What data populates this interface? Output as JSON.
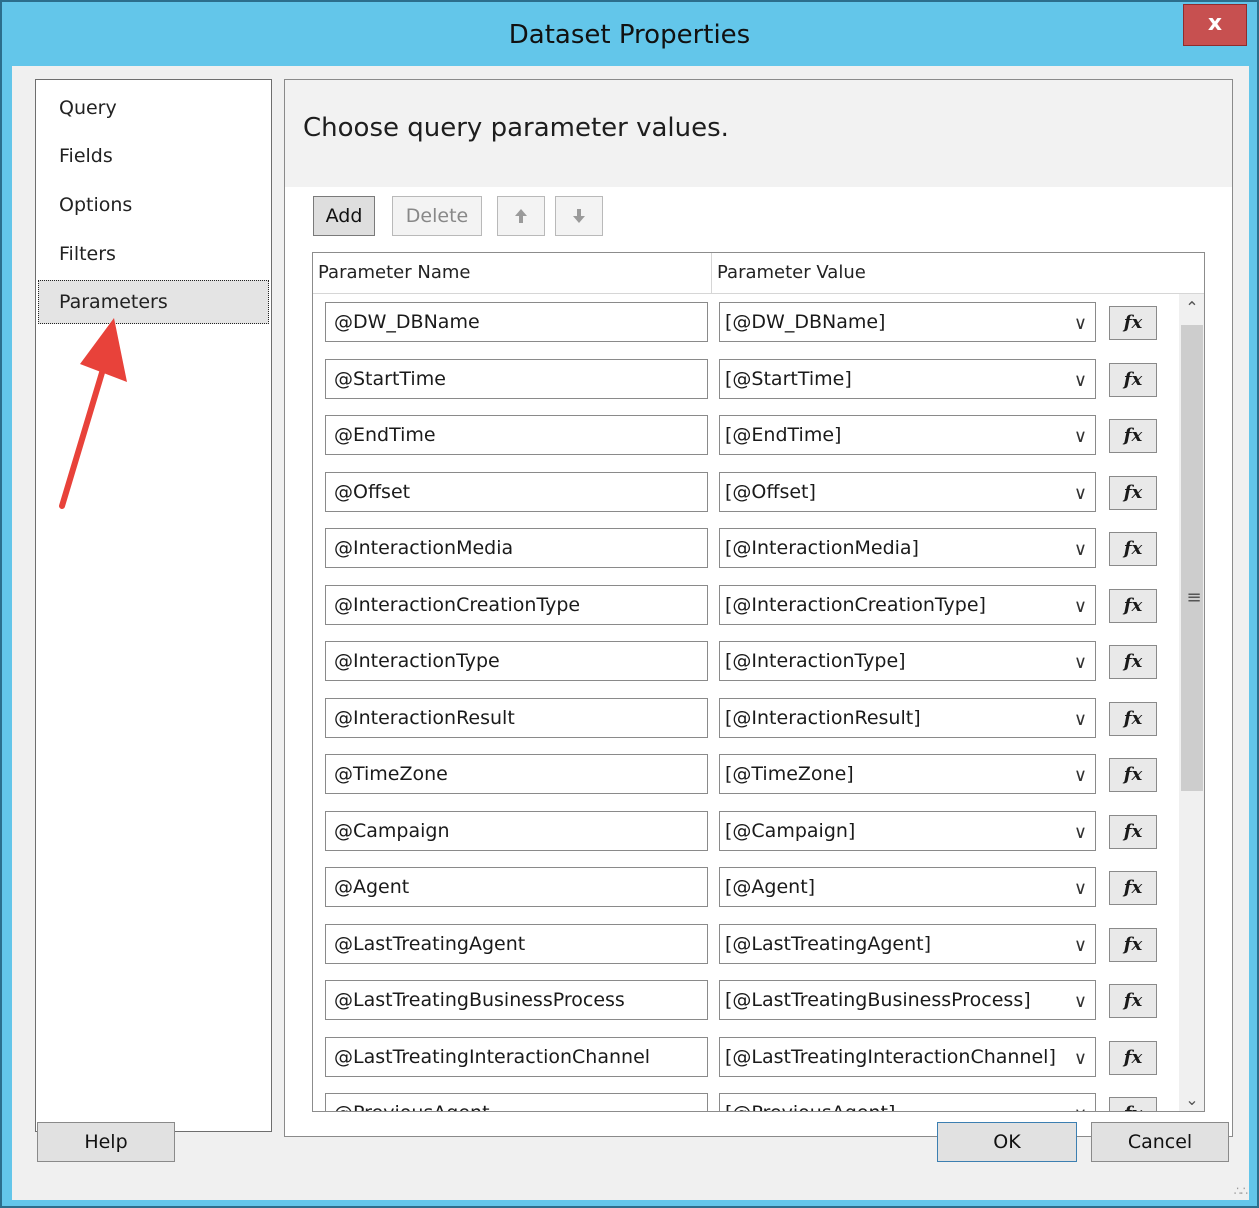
{
  "window": {
    "title": "Dataset Properties",
    "close_label": "x"
  },
  "nav": {
    "items": [
      {
        "label": "Query"
      },
      {
        "label": "Fields"
      },
      {
        "label": "Options"
      },
      {
        "label": "Filters"
      },
      {
        "label": "Parameters",
        "selected": true
      }
    ]
  },
  "main": {
    "heading": "Choose query parameter values.",
    "toolbar": {
      "add": "Add",
      "delete": "Delete",
      "up_icon": "arrow-up-icon",
      "down_icon": "arrow-down-icon"
    },
    "columns": {
      "name": "Parameter Name",
      "value": "Parameter Value"
    },
    "rows": [
      {
        "name": "@DW_DBName",
        "value": "[@DW_DBName]"
      },
      {
        "name": "@StartTime",
        "value": "[@StartTime]"
      },
      {
        "name": "@EndTime",
        "value": "[@EndTime]"
      },
      {
        "name": "@Offset",
        "value": "[@Offset]"
      },
      {
        "name": "@InteractionMedia",
        "value": "[@InteractionMedia]"
      },
      {
        "name": "@InteractionCreationType",
        "value": "[@InteractionCreationType]"
      },
      {
        "name": "@InteractionType",
        "value": "[@InteractionType]"
      },
      {
        "name": "@InteractionResult",
        "value": "[@InteractionResult]"
      },
      {
        "name": "@TimeZone",
        "value": "[@TimeZone]"
      },
      {
        "name": "@Campaign",
        "value": "[@Campaign]"
      },
      {
        "name": "@Agent",
        "value": "[@Agent]"
      },
      {
        "name": "@LastTreatingAgent",
        "value": "[@LastTreatingAgent]"
      },
      {
        "name": "@LastTreatingBusinessProcess",
        "value": "[@LastTreatingBusinessProcess]"
      },
      {
        "name": "@LastTreatingInteractionChannel",
        "value": "[@LastTreatingInteractionChannel]"
      },
      {
        "name": "@PreviousAgent",
        "value": "[@PreviousAgent]"
      }
    ],
    "fx_label": "fx"
  },
  "footer": {
    "help": "Help",
    "ok": "OK",
    "cancel": "Cancel"
  },
  "colors": {
    "titlebar": "#63c6ea",
    "close": "#c75050",
    "arrow": "#e8423a"
  }
}
